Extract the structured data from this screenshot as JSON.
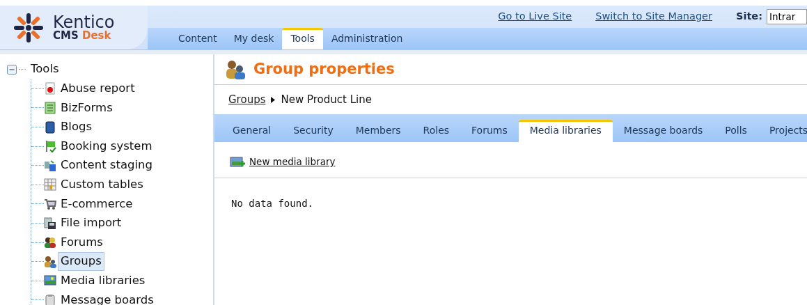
{
  "header": {
    "logo": {
      "name": "Kentico",
      "product": "CMS",
      "edition": "Desk"
    },
    "links": [
      "Go to Live Site",
      "Switch to Site Manager"
    ],
    "site": {
      "label": "Site:",
      "value": "Intrar"
    },
    "tabs": [
      {
        "label": "Content",
        "selected": false
      },
      {
        "label": "My desk",
        "selected": false
      },
      {
        "label": "Tools",
        "selected": true
      },
      {
        "label": "Administration",
        "selected": false
      }
    ]
  },
  "tree": {
    "root": {
      "label": "Tools",
      "expanded": true
    },
    "children": [
      {
        "label": "Abuse report",
        "selected": false
      },
      {
        "label": "BizForms",
        "selected": false
      },
      {
        "label": "Blogs",
        "selected": false
      },
      {
        "label": "Booking system",
        "selected": false
      },
      {
        "label": "Content staging",
        "selected": false
      },
      {
        "label": "Custom tables",
        "selected": false
      },
      {
        "label": "E-commerce",
        "selected": false
      },
      {
        "label": "File import",
        "selected": false
      },
      {
        "label": "Forums",
        "selected": false
      },
      {
        "label": "Groups",
        "selected": true
      },
      {
        "label": "Media libraries",
        "selected": false
      },
      {
        "label": "Message boards",
        "selected": false
      }
    ]
  },
  "content": {
    "title": "Group properties",
    "breadcrumb": [
      "Groups",
      "New Product Line"
    ],
    "tabs": [
      {
        "label": "General",
        "selected": false
      },
      {
        "label": "Security",
        "selected": false
      },
      {
        "label": "Members",
        "selected": false
      },
      {
        "label": "Roles",
        "selected": false
      },
      {
        "label": "Forums",
        "selected": false
      },
      {
        "label": "Media libraries",
        "selected": true
      },
      {
        "label": "Message boards",
        "selected": false
      },
      {
        "label": "Polls",
        "selected": false
      },
      {
        "label": "Projects",
        "selected": false
      }
    ],
    "action": "New media library",
    "message": "No data found."
  }
}
